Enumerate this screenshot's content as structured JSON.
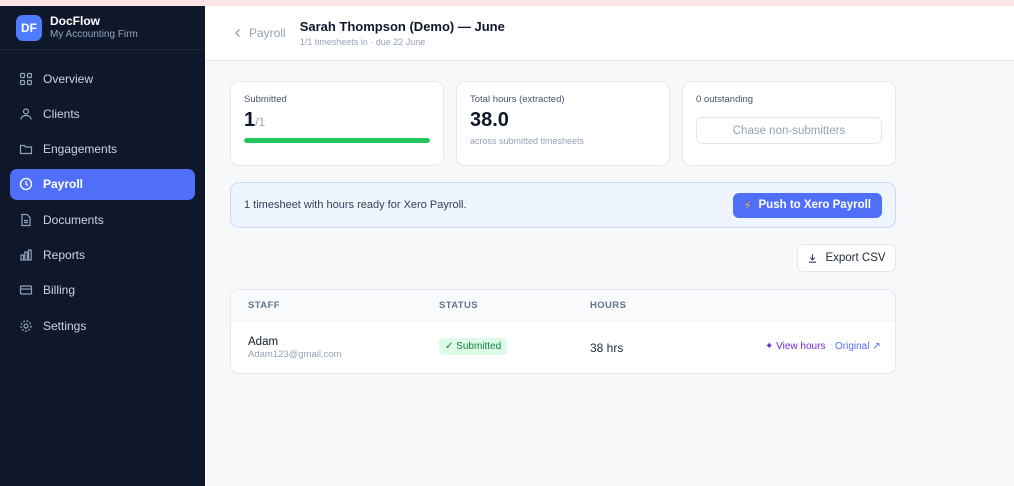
{
  "brand": {
    "initials": "DF",
    "name": "DocFlow",
    "firm": "My Accounting Firm"
  },
  "sidebar": {
    "items": [
      {
        "label": "Overview",
        "icon": "grid-icon"
      },
      {
        "label": "Clients",
        "icon": "users-icon"
      },
      {
        "label": "Engagements",
        "icon": "folder-icon"
      },
      {
        "label": "Payroll",
        "icon": "clock-icon",
        "active": true
      },
      {
        "label": "Documents",
        "icon": "document-icon"
      },
      {
        "label": "Reports",
        "icon": "bar-chart-icon"
      },
      {
        "label": "Billing",
        "icon": "card-icon"
      },
      {
        "label": "Settings",
        "icon": "gear-icon"
      }
    ]
  },
  "header": {
    "back_label": "Payroll",
    "title": "Sarah Thompson (Demo) — June",
    "subtitle": "1/1 timesheets in · due 22 June"
  },
  "cards": {
    "submitted": {
      "label": "Submitted",
      "value": "1",
      "total": "/1",
      "progress_percent": 100
    },
    "hours": {
      "label": "Total hours (extracted)",
      "value": "38.0",
      "note": "across submitted timesheets"
    },
    "outstanding": {
      "label": "0 outstanding",
      "button": "Chase non-submitters"
    }
  },
  "banner": {
    "text": "1 timesheet with hours ready for Xero Payroll.",
    "button": "Push to Xero Payroll"
  },
  "export_label": "Export CSV",
  "table": {
    "headers": {
      "staff": "STAFF",
      "status": "STATUS",
      "hours": "HOURS"
    },
    "rows": [
      {
        "name": "Adam",
        "email": "Adam123@gmail.com",
        "status": "✓ Submitted",
        "hours": "38 hrs",
        "view": "✦ View hours",
        "original": "Original ↗"
      }
    ]
  },
  "colors": {
    "accent": "#4f6ff8",
    "sidebar_bg": "#0f172a",
    "success": "#22c55e"
  }
}
